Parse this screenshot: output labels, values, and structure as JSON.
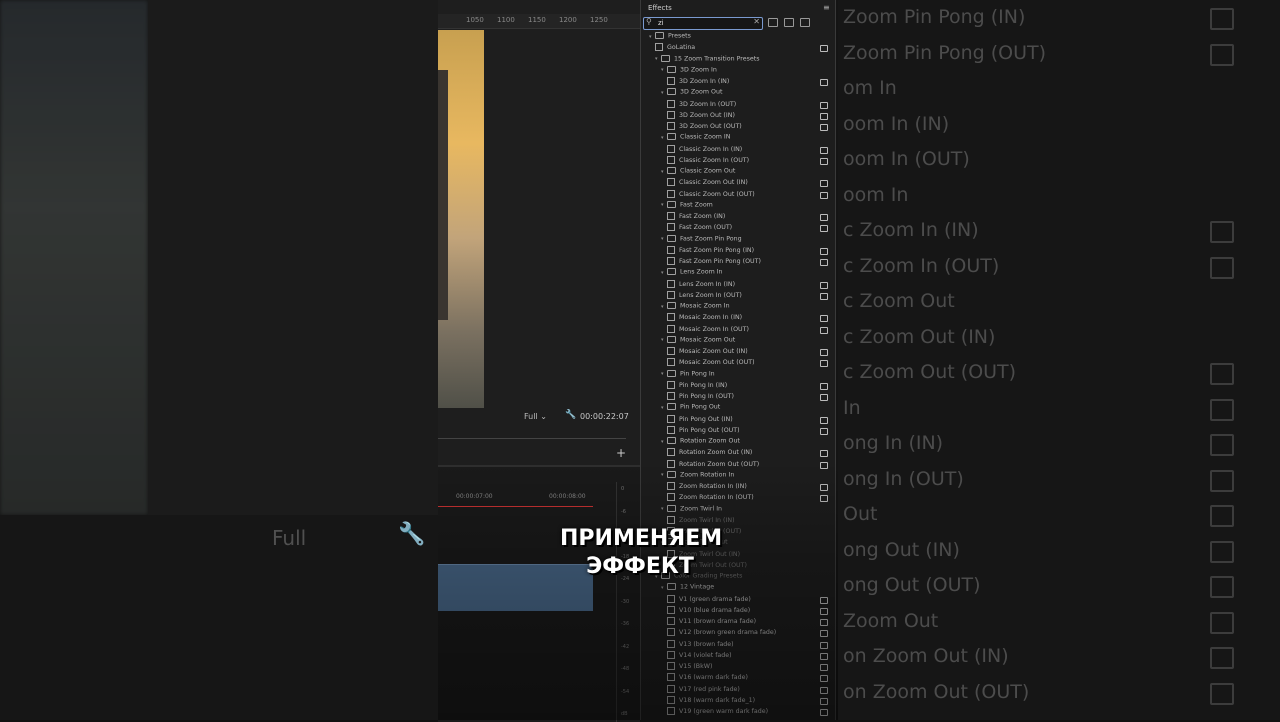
{
  "background": {
    "full_label": "Full",
    "ghost_items": [
      "Zoom Pin Pong (IN)",
      "Zoom Pin Pong (OUT)",
      "om In",
      "oom In (IN)",
      "oom In (OUT)",
      "oom In",
      "c Zoom In (IN)",
      "c Zoom In (OUT)",
      "c Zoom Out",
      "c Zoom Out (IN)",
      "c Zoom Out (OUT)",
      "In",
      "ong In (IN)",
      "ong In (OUT)",
      "Out",
      "ong Out (IN)",
      "ong Out (OUT)",
      "Zoom Out",
      "on Zoom Out (IN)",
      "on Zoom Out (OUT)"
    ]
  },
  "monitor": {
    "ruler_ticks": [
      "1050",
      "1100",
      "1150",
      "1200",
      "1250"
    ],
    "resolution": "Full",
    "timecode": "00:00:22:07",
    "timeline_ticks": [
      "00:00:07:00",
      "00:00:08:00"
    ],
    "vu_ticks": [
      "0",
      "-6",
      "-12",
      "-18",
      "-24",
      "-30",
      "-36",
      "-42",
      "-48",
      "-54",
      "dB"
    ]
  },
  "effects": {
    "title": "Effects",
    "search_value": "zi",
    "tree": [
      {
        "label": "Presets",
        "level": 0,
        "kind": "folder",
        "badge": false
      },
      {
        "label": "GoLatina",
        "level": 1,
        "kind": "preset",
        "badge": true
      },
      {
        "label": "15 Zoom Transition Presets",
        "level": 1,
        "kind": "folder",
        "badge": false
      },
      {
        "label": "3D Zoom In",
        "level": 2,
        "kind": "folder",
        "badge": false
      },
      {
        "label": "3D Zoom In (IN)",
        "level": 3,
        "kind": "preset",
        "badge": true
      },
      {
        "label": "3D Zoom Out",
        "level": 2,
        "kind": "folder",
        "badge": false
      },
      {
        "label": "3D Zoom In (OUT)",
        "level": 3,
        "kind": "preset",
        "badge": true
      },
      {
        "label": "3D Zoom Out (IN)",
        "level": 3,
        "kind": "preset",
        "badge": true
      },
      {
        "label": "3D Zoom Out (OUT)",
        "level": 3,
        "kind": "preset",
        "badge": true
      },
      {
        "label": "Classic Zoom IN",
        "level": 2,
        "kind": "folder",
        "badge": false
      },
      {
        "label": "Classic Zoom In (IN)",
        "level": 3,
        "kind": "preset",
        "badge": true
      },
      {
        "label": "Classic Zoom In (OUT)",
        "level": 3,
        "kind": "preset",
        "badge": true
      },
      {
        "label": "Classic Zoom Out",
        "level": 2,
        "kind": "folder",
        "badge": false
      },
      {
        "label": "Classic Zoom Out (IN)",
        "level": 3,
        "kind": "preset",
        "badge": true
      },
      {
        "label": "Classic Zoom Out (OUT)",
        "level": 3,
        "kind": "preset",
        "badge": true
      },
      {
        "label": "Fast Zoom",
        "level": 2,
        "kind": "folder",
        "badge": false
      },
      {
        "label": "Fast Zoom (IN)",
        "level": 3,
        "kind": "preset",
        "badge": true
      },
      {
        "label": "Fast Zoom (OUT)",
        "level": 3,
        "kind": "preset",
        "badge": true
      },
      {
        "label": "Fast Zoom Pin Pong",
        "level": 2,
        "kind": "folder",
        "badge": false
      },
      {
        "label": "Fast Zoom Pin Pong (IN)",
        "level": 3,
        "kind": "preset",
        "badge": true
      },
      {
        "label": "Fast Zoom Pin Pong (OUT)",
        "level": 3,
        "kind": "preset",
        "badge": true
      },
      {
        "label": "Lens Zoom In",
        "level": 2,
        "kind": "folder",
        "badge": false
      },
      {
        "label": "Lens Zoom In (IN)",
        "level": 3,
        "kind": "preset",
        "badge": true
      },
      {
        "label": "Lens Zoom In (OUT)",
        "level": 3,
        "kind": "preset",
        "badge": true
      },
      {
        "label": "Mosaic Zoom In",
        "level": 2,
        "kind": "folder",
        "badge": false
      },
      {
        "label": "Mosaic Zoom In (IN)",
        "level": 3,
        "kind": "preset",
        "badge": true
      },
      {
        "label": "Mosaic Zoom In (OUT)",
        "level": 3,
        "kind": "preset",
        "badge": true
      },
      {
        "label": "Mosaic Zoom Out",
        "level": 2,
        "kind": "folder",
        "badge": false
      },
      {
        "label": "Mosaic Zoom Out (IN)",
        "level": 3,
        "kind": "preset",
        "badge": true
      },
      {
        "label": "Mosaic Zoom Out (OUT)",
        "level": 3,
        "kind": "preset",
        "badge": true
      },
      {
        "label": "Pin Pong In",
        "level": 2,
        "kind": "folder",
        "badge": false
      },
      {
        "label": "Pin Pong In (IN)",
        "level": 3,
        "kind": "preset",
        "badge": true
      },
      {
        "label": "Pin Pong In (OUT)",
        "level": 3,
        "kind": "preset",
        "badge": true
      },
      {
        "label": "Pin Pong Out",
        "level": 2,
        "kind": "folder",
        "badge": false
      },
      {
        "label": "Pin Pong Out (IN)",
        "level": 3,
        "kind": "preset",
        "badge": true
      },
      {
        "label": "Pin Pong Out (OUT)",
        "level": 3,
        "kind": "preset",
        "badge": true
      },
      {
        "label": "Rotation Zoom Out",
        "level": 2,
        "kind": "folder",
        "badge": false
      },
      {
        "label": "Rotation Zoom Out (IN)",
        "level": 3,
        "kind": "preset",
        "badge": true
      },
      {
        "label": "Rotation Zoom Out (OUT)",
        "level": 3,
        "kind": "preset",
        "badge": true
      },
      {
        "label": "Zoom Rotation In",
        "level": 2,
        "kind": "folder",
        "badge": false
      },
      {
        "label": "Zoom Rotation In (IN)",
        "level": 3,
        "kind": "preset",
        "badge": true
      },
      {
        "label": "Zoom Rotation In (OUT)",
        "level": 3,
        "kind": "preset",
        "badge": true
      },
      {
        "label": "Zoom Twirl In",
        "level": 2,
        "kind": "folder",
        "badge": false
      },
      {
        "label": "Zoom Twirl In (IN)",
        "level": 3,
        "kind": "preset",
        "badge": false
      },
      {
        "label": "Zoom Twirl In (OUT)",
        "level": 3,
        "kind": "preset",
        "badge": false
      },
      {
        "label": "Zoom Twirl Out",
        "level": 2,
        "kind": "folder",
        "badge": false
      },
      {
        "label": "Zoom Twirl Out (IN)",
        "level": 3,
        "kind": "preset",
        "badge": false
      },
      {
        "label": "Zoom Twirl Out (OUT)",
        "level": 3,
        "kind": "preset",
        "badge": false
      },
      {
        "label": "Color Grading Presets",
        "level": 1,
        "kind": "folder",
        "badge": false
      },
      {
        "label": "12 Vintage",
        "level": 2,
        "kind": "folder",
        "badge": false
      },
      {
        "label": "V1 (green drama fade)",
        "level": 3,
        "kind": "preset",
        "badge": true
      },
      {
        "label": "V10 (blue drama fade)",
        "level": 3,
        "kind": "preset",
        "badge": true
      },
      {
        "label": "V11 (brown drama fade)",
        "level": 3,
        "kind": "preset",
        "badge": true
      },
      {
        "label": "V12 (brown green drama fade)",
        "level": 3,
        "kind": "preset",
        "badge": true
      },
      {
        "label": "V13 (brown fade)",
        "level": 3,
        "kind": "preset",
        "badge": true
      },
      {
        "label": "V14 (violet fade)",
        "level": 3,
        "kind": "preset",
        "badge": true
      },
      {
        "label": "V15 (BkW)",
        "level": 3,
        "kind": "preset",
        "badge": true
      },
      {
        "label": "V16 (warm dark fade)",
        "level": 3,
        "kind": "preset",
        "badge": true
      },
      {
        "label": "V17 (red pink fade)",
        "level": 3,
        "kind": "preset",
        "badge": true
      },
      {
        "label": "V18 (warm dark fade_1)",
        "level": 3,
        "kind": "preset",
        "badge": true
      },
      {
        "label": "V19 (green warm dark fade)",
        "level": 3,
        "kind": "preset",
        "badge": true
      }
    ]
  },
  "caption": {
    "line1": "ПРИМЕНЯЕМ",
    "line2": "ЭФФЕКТ"
  }
}
